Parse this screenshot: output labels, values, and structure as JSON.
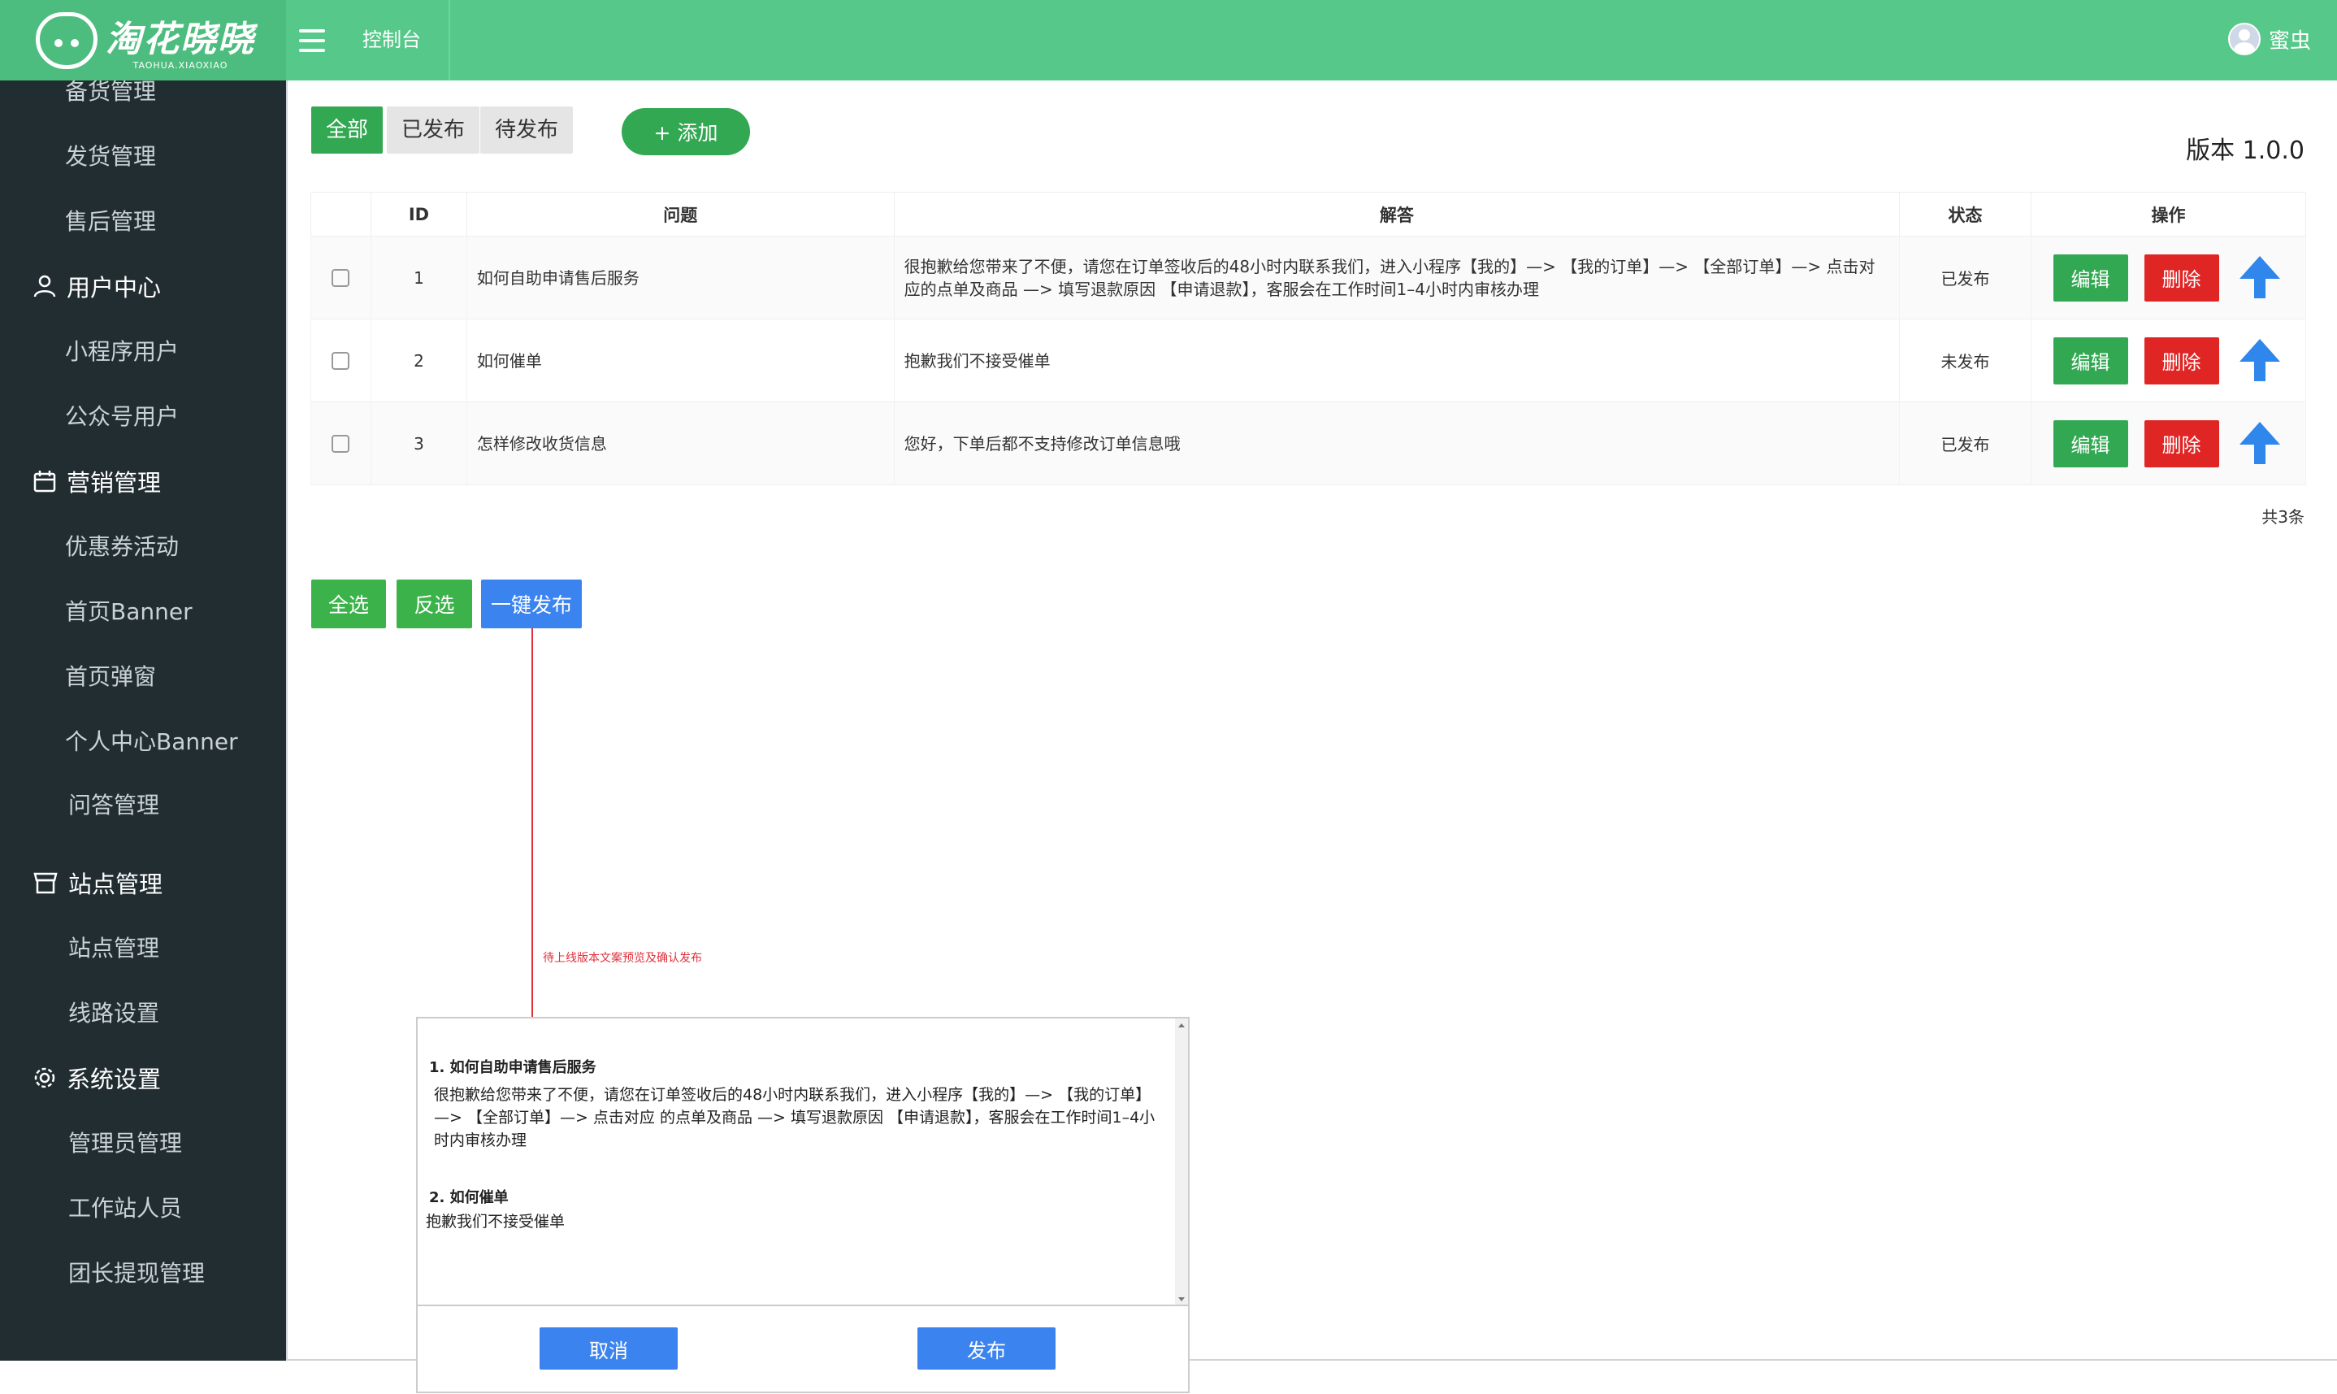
{
  "header": {
    "brand_cn": "淘花晓晓",
    "brand_en": "TAOHUA.XIAOXIAO",
    "console_label": "控制台",
    "user_name": "蜜虫"
  },
  "sidebar": {
    "items": [
      {
        "label": "备货管理",
        "type": "item"
      },
      {
        "label": "发货管理",
        "type": "item"
      },
      {
        "label": "售后管理",
        "type": "item"
      },
      {
        "label": "用户中心",
        "type": "group",
        "icon": "user-icon"
      },
      {
        "label": "小程序用户",
        "type": "item"
      },
      {
        "label": "公众号用户",
        "type": "item"
      },
      {
        "label": "营销管理",
        "type": "group",
        "icon": "calendar-icon"
      },
      {
        "label": "优惠券活动",
        "type": "item"
      },
      {
        "label": "首页Banner",
        "type": "item"
      },
      {
        "label": "首页弹窗",
        "type": "item"
      },
      {
        "label": "个人中心Banner",
        "type": "item"
      },
      {
        "label": "问答管理",
        "type": "item"
      },
      {
        "label": "站点管理",
        "type": "group",
        "icon": "shop-icon"
      },
      {
        "label": "站点管理",
        "type": "item"
      },
      {
        "label": "线路设置",
        "type": "item"
      },
      {
        "label": "系统设置",
        "type": "group",
        "icon": "gear-icon"
      },
      {
        "label": "管理员管理",
        "type": "item"
      },
      {
        "label": "工作站人员",
        "type": "item"
      },
      {
        "label": "团长提现管理",
        "type": "item"
      }
    ]
  },
  "filters": {
    "tabs": [
      "全部",
      "已发布",
      "待发布"
    ],
    "active": "全部",
    "add_label": "+ 添加"
  },
  "version_label": "版本 1.0.0",
  "table": {
    "columns": [
      "",
      "ID",
      "问题",
      "解答",
      "状态",
      "操作"
    ],
    "rows": [
      {
        "id": "1",
        "question": "如何自助申请售后服务",
        "answer": "很抱歉给您带来了不便，请您在订单签收后的48小时内联系我们，进入小程序【我的】—> 【我的订单】—> 【全部订单】—> 点击对应的点单及商品 —> 填写退款原因 【申请退款】，客服会在工作时间1–4小时内审核办理",
        "status": "已发布"
      },
      {
        "id": "2",
        "question": "如何催单",
        "answer": "抱歉我们不接受催单",
        "status": "未发布"
      },
      {
        "id": "3",
        "question": "怎样修改收货信息",
        "answer": "您好，下单后都不支持修改订单信息哦",
        "status": "已发布"
      }
    ],
    "edit_label": "编辑",
    "delete_label": "删除",
    "total_label": "共3条"
  },
  "bulk_actions": {
    "select_all": "全选",
    "invert": "反选",
    "publish_all": "一键发布"
  },
  "annotation": "待上线版本文案预览及确认发布",
  "dialog": {
    "q1_title": "1. 如何自助申请售后服务",
    "q1_answer": "很抱歉给您带来了不便，请您在订单签收后的48小时内联系我们，进入小程序【我的】—> 【我的订单】—> 【全部订单】—> 点击对应 的点单及商品 —> 填写退款原因 【申请退款】，客服会在工作时间1–4小时内审核办理",
    "q2_title": "2. 如何催单",
    "q2_answer": "抱歉我们不接受催单",
    "cancel_label": "取消",
    "publish_label": "发布"
  },
  "colors": {
    "header_green": "#56c98a",
    "sidebar_dark": "#222d32",
    "button_green": "#32a852",
    "button_red": "#e02525",
    "button_blue": "#3b84ef",
    "annotation_red": "#e0303a"
  }
}
